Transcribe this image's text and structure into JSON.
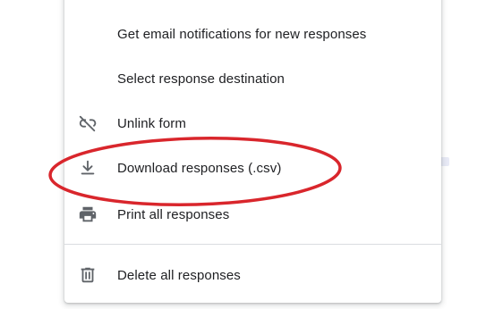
{
  "menu": {
    "items": [
      {
        "label": "Get email notifications for new responses",
        "icon": "none"
      },
      {
        "label": "Select response destination",
        "icon": "none"
      },
      {
        "label": "Unlink form",
        "icon": "link-off-icon"
      },
      {
        "label": "Download responses (.csv)",
        "icon": "download-icon"
      },
      {
        "label": "Print all responses",
        "icon": "print-icon"
      },
      {
        "label": "Delete all responses",
        "icon": "trash-icon"
      }
    ]
  },
  "colors": {
    "text": "#202124",
    "icon": "#5f6368",
    "divider": "#dadce0",
    "highlight_ring": "#d9262c"
  }
}
